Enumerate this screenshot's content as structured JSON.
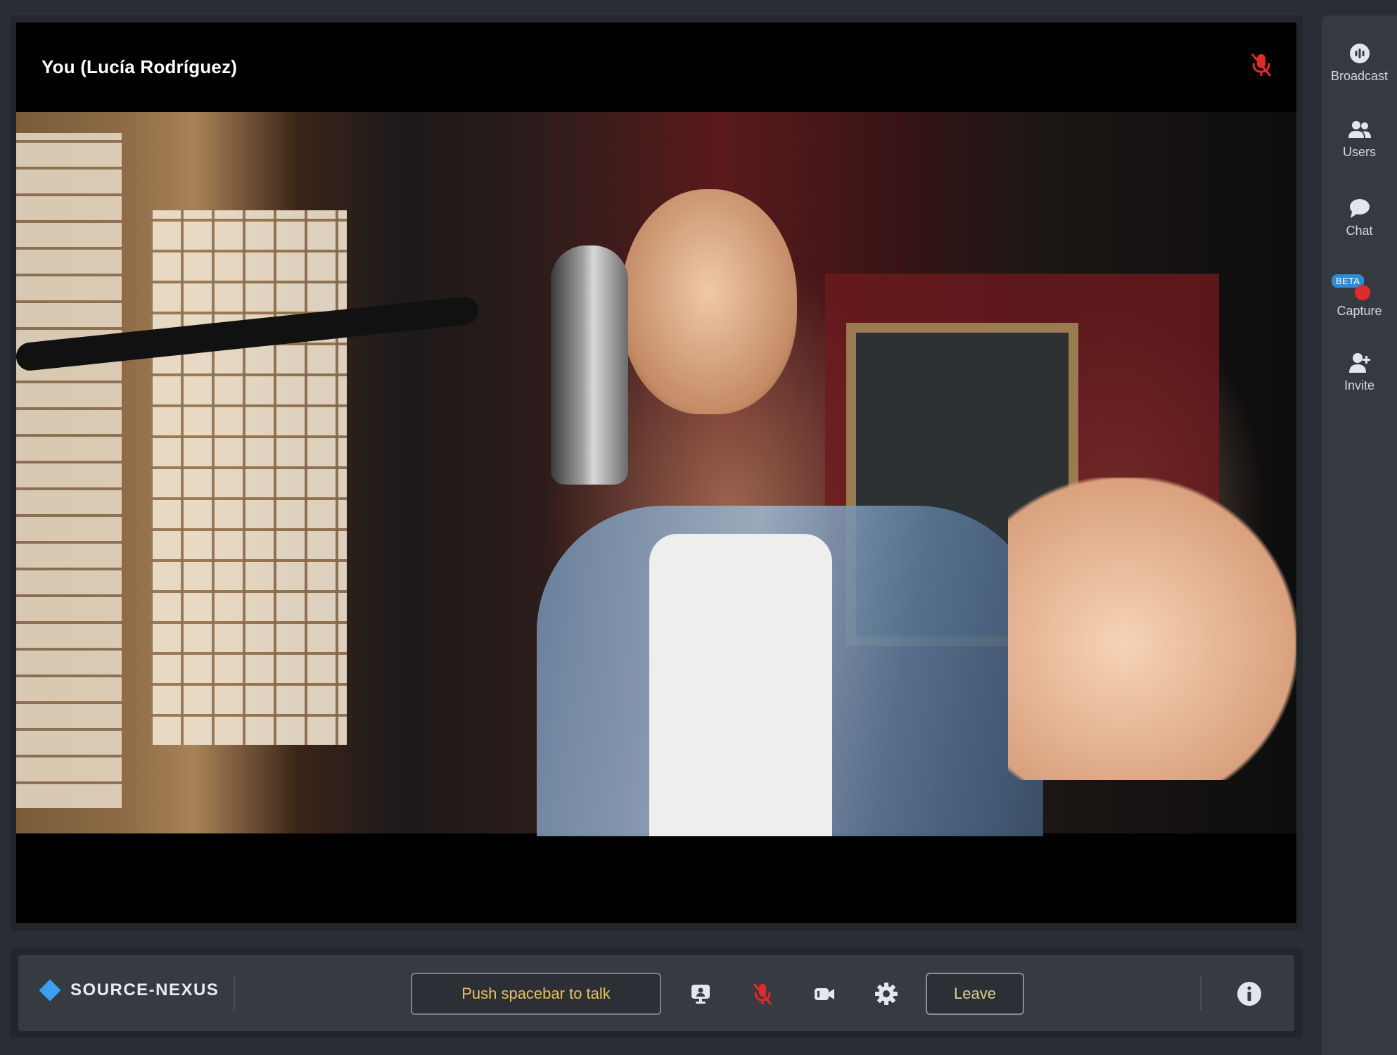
{
  "stage": {
    "participant_name": "You (Lucía Rodríguez)",
    "video_description_icon": "muted-mic-icon"
  },
  "sidebar": {
    "items": [
      {
        "label": "Broadcast",
        "icon": "broadcast-icon"
      },
      {
        "label": "Users",
        "icon": "users-icon"
      },
      {
        "label": "Chat",
        "icon": "chat-icon"
      },
      {
        "label": "Capture",
        "icon": "record-icon",
        "badge": "BETA"
      },
      {
        "label": "Invite",
        "icon": "add-user-icon"
      }
    ]
  },
  "bar": {
    "brand_name": "SOURCE-NEXUS",
    "push_to_talk_label": "Push spacebar to talk",
    "leave_label": "Leave",
    "icons": [
      "screen-share-icon",
      "muted-mic-icon",
      "camera-icon",
      "gear-icon",
      "info-icon"
    ]
  },
  "colors": {
    "brand_accent": "#3aa0ef",
    "ptt_text": "#e8c25a",
    "mute_red": "#e02b2b",
    "leave_text": "#d6d08a",
    "beta_badge": "#2f8bd6"
  }
}
